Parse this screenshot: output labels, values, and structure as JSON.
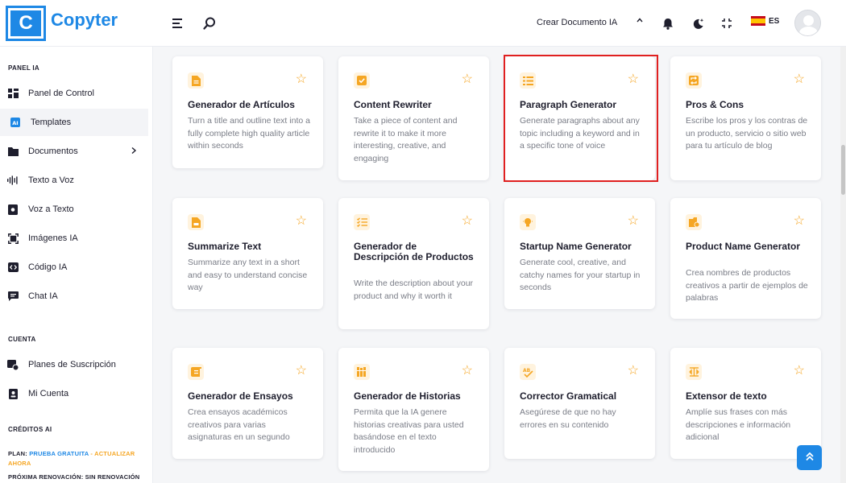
{
  "brand": {
    "logo_letter": "C",
    "name": "Copyter"
  },
  "header": {
    "create_document": "Crear Documento IA",
    "language": "ES",
    "icons": [
      "menu-icon",
      "search-icon",
      "chevron-up-icon",
      "bell-icon",
      "theme-toggle-icon",
      "collapse-icon",
      "spain-flag-icon"
    ]
  },
  "sidebar": {
    "panel_label": "PANEL IA",
    "items": [
      {
        "label": "Panel de Control",
        "icon": "dashboard-icon"
      },
      {
        "label": "Templates",
        "icon": "ai-templates-icon",
        "active": true
      },
      {
        "label": "Documentos",
        "icon": "folder-icon",
        "has_submenu": true
      },
      {
        "label": "Texto a Voz",
        "icon": "soundwave-icon"
      },
      {
        "label": "Voz a Texto",
        "icon": "voice-file-icon"
      },
      {
        "label": "Imágenes IA",
        "icon": "image-scan-icon"
      },
      {
        "label": "Código IA",
        "icon": "code-icon"
      },
      {
        "label": "Chat IA",
        "icon": "chat-icon"
      }
    ],
    "account_label": "CUENTA",
    "account_items": [
      {
        "label": "Planes de Suscripción",
        "icon": "subscription-icon"
      },
      {
        "label": "Mi Cuenta",
        "icon": "account-icon"
      }
    ],
    "credits_label": "CRÉDITOS AI",
    "plan_prefix": "PLAN:",
    "plan_name": "PRUEBA GRATUITA",
    "plan_separator": "-",
    "upgrade": "ACTUALIZAR AHORA",
    "renewal": "PRÓXIMA RENOVACIÓN: SIN RENOVACIÓN"
  },
  "templates": [
    {
      "title": "Generador de Artículos",
      "desc": "Turn a title and outline text into a fully complete high quality article within seconds",
      "icon": "document-icon"
    },
    {
      "title": "Content Rewriter",
      "desc": "Take a piece of content and rewrite it to make it more interesting, creative, and engaging",
      "icon": "checkbox-icon"
    },
    {
      "title": "Paragraph Generator",
      "desc": "Generate paragraphs about any topic including a keyword and in a specific tone of voice",
      "icon": "paragraph-icon"
    },
    {
      "title": "Pros & Cons",
      "desc": "Escribe los pros y los contras de un producto, servicio o sitio web para tu artículo de blog",
      "icon": "swap-icon"
    },
    {
      "title": "Summarize Text",
      "desc": "Summarize any text in a short and easy to understand concise way",
      "icon": "file-icon"
    },
    {
      "title": "Generador de Descripción de Productos",
      "desc": "Write the description about your product and why it worth it",
      "icon": "checklist-icon"
    },
    {
      "title": "Startup Name Generator",
      "desc": "Generate cool, creative, and catchy names for your startup in seconds",
      "icon": "lightbulb-icon"
    },
    {
      "title": "Product Name Generator",
      "desc": "Crea nombres de productos creativos a partir de ejemplos de palabras",
      "icon": "product-icon"
    },
    {
      "title": "Generador de Ensayos",
      "desc": "Crea ensayos académicos creativos para varias asignaturas en un segundo",
      "icon": "scroll-icon"
    },
    {
      "title": "Generador de Historias",
      "desc": "Permita que la IA genere historias creativas para usted basándose en el texto introducido",
      "icon": "books-icon"
    },
    {
      "title": "Corrector Gramatical",
      "desc": "Asegúrese de que no hay errores en su contenido",
      "icon": "spellcheck-icon"
    },
    {
      "title": "Extensor de texto",
      "desc": "Amplíe sus frases con más descripciones e información adicional",
      "icon": "expand-text-icon"
    }
  ],
  "colors": {
    "accent": "#1e88e5",
    "icon_orange": "#f5a623",
    "highlight": "#e02020"
  }
}
